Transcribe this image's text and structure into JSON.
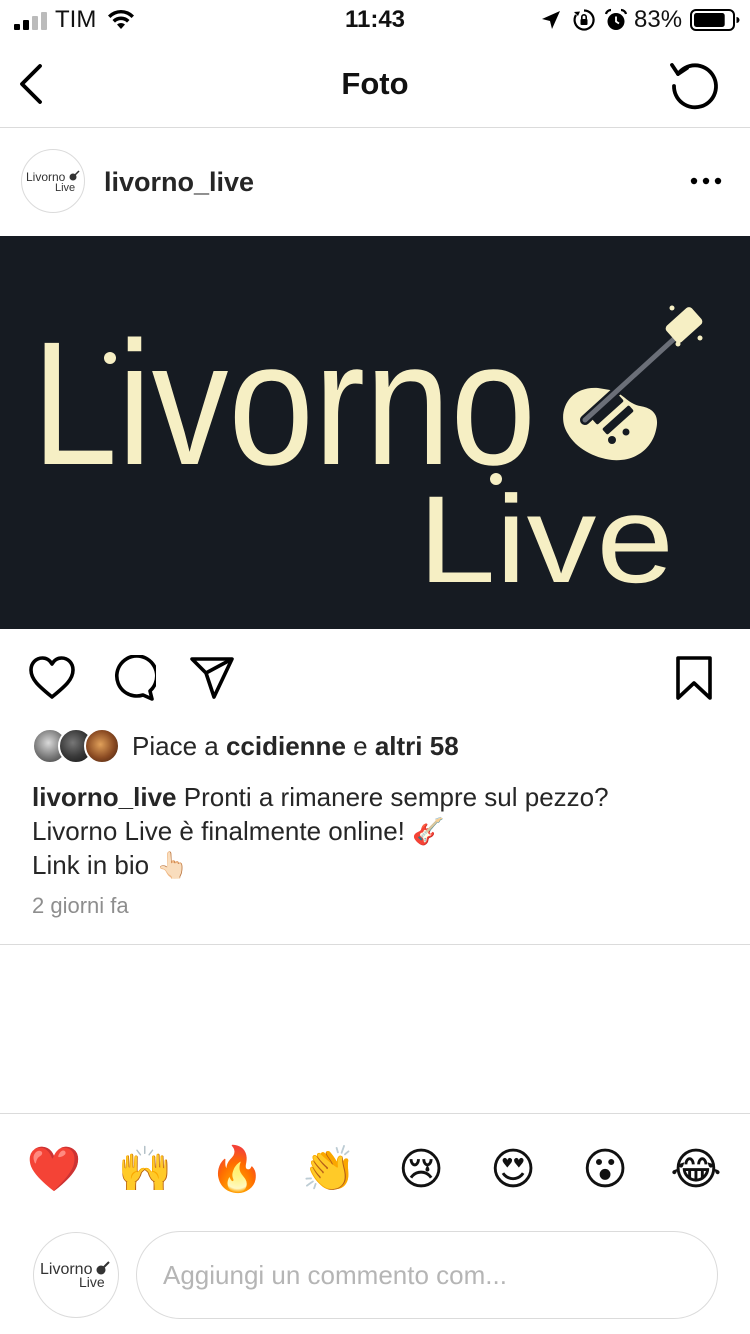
{
  "status_bar": {
    "carrier": "TIM",
    "time": "11:43",
    "battery_percent": "83%",
    "battery_level": 0.83,
    "icons": [
      "signal-icon",
      "wifi-icon",
      "location-icon",
      "orientation-lock-icon",
      "alarm-icon",
      "battery-icon"
    ]
  },
  "nav": {
    "title": "Foto",
    "back_icon": "chevron-left-icon",
    "refresh_icon": "refresh-icon"
  },
  "post": {
    "username": "livorno_live",
    "logo_text_line1": "Livorno",
    "logo_text_line2": "Live",
    "likes": {
      "prefix": "Piace a",
      "user": "ccidienne",
      "connector": "e",
      "others": "altri 58"
    },
    "caption": {
      "user": "livorno_live",
      "line1": "Pronti a rimanere sempre sul pezzo?",
      "line2": "Livorno Live è finalmente online! 🎸",
      "line3": "Link in bio 👆🏻"
    },
    "timestamp": "2 giorni fa"
  },
  "reactions": [
    "❤️",
    "🙌",
    "🔥",
    "👏",
    "😢",
    "😍",
    "😮",
    "😂"
  ],
  "comment": {
    "placeholder": "Aggiungi un commento com..."
  },
  "colors": {
    "image_bg": "#161b22",
    "logo_cream": "#f6efc4",
    "divider": "#dbdbdb",
    "muted_text": "#8e8e8e"
  }
}
